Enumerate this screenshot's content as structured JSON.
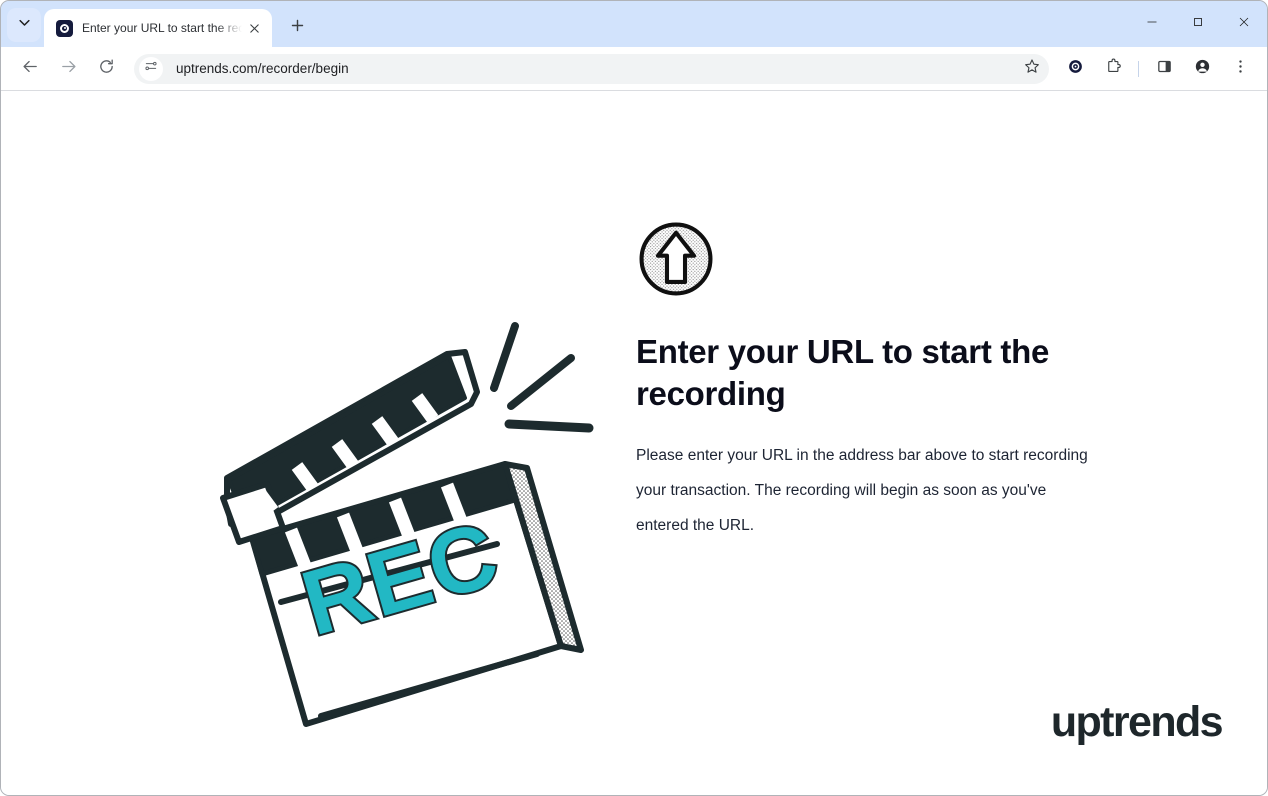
{
  "browser": {
    "tab_search_icon": "chevron-down-icon",
    "tab": {
      "favicon": "recorder-circle-icon",
      "title": "Enter your URL to start the reco",
      "close_icon": "close-icon"
    },
    "new_tab_icon": "plus-icon",
    "window_controls": {
      "minimize": "minimize-icon",
      "maximize": "maximize-icon",
      "close": "close-icon"
    },
    "toolbar": {
      "back_icon": "back-arrow-icon",
      "forward_icon": "forward-arrow-icon",
      "reload_icon": "reload-icon",
      "site_info_icon": "tune-sliders-icon",
      "url": "uptrends.com/recorder/begin",
      "bookmark_icon": "star-icon",
      "extension_recorder_icon": "uptrends-recorder-icon",
      "extensions_icon": "puzzle-piece-icon",
      "side_panel_icon": "side-panel-icon",
      "profile_icon": "profile-avatar-icon",
      "menu_icon": "three-dot-menu-icon"
    }
  },
  "content": {
    "badge_icon": "arrow-up-circle-icon",
    "illustration": {
      "name": "clapperboard-illustration",
      "label": "REC",
      "rec_color": "#22b8c4",
      "ink_color": "#1d2b2e"
    },
    "heading": "Enter your URL to start the recording",
    "paragraph": "Please enter your URL in the address bar above to start recording your transaction. The recording will begin as soon as you've entered the URL.",
    "brand": "uptrends",
    "brand_color": "#1e272b"
  }
}
